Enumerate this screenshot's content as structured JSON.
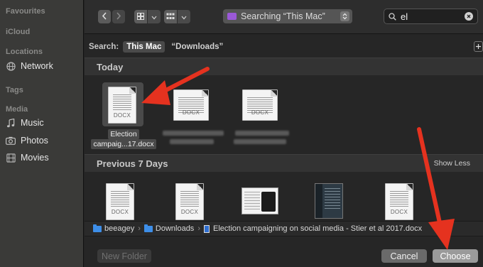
{
  "sidebar": {
    "favourites_header": "Favourites",
    "icloud_header": "iCloud",
    "locations_header": "Locations",
    "tags_header": "Tags",
    "media_header": "Media",
    "network": {
      "label": "Network",
      "icon": "globe-icon"
    },
    "music": {
      "label": "Music",
      "icon": "music-note-icon"
    },
    "photos": {
      "label": "Photos",
      "icon": "camera-icon"
    },
    "movies": {
      "label": "Movies",
      "icon": "film-icon"
    }
  },
  "toolbar": {
    "back_icon": "chevron-left-icon",
    "forward_icon": "chevron-right-icon",
    "location_label": "Searching “This Mac”",
    "search_value": "el"
  },
  "scope": {
    "label": "Search:",
    "this_mac": "This Mac",
    "downloads": "“Downloads”",
    "add_icon": "plus-icon"
  },
  "sections": {
    "today": "Today",
    "previous": "Previous 7 Days",
    "show_less": "Show Less"
  },
  "files": {
    "selected_name_line1": "Election",
    "selected_name_line2": "campaig...17.docx",
    "docx_tag": "DOCX"
  },
  "pathbar": {
    "user": "beeagey",
    "folder": "Downloads",
    "file": "Election campaigning on social media - Stier et al 2017.docx",
    "separator": "›"
  },
  "footer": {
    "new_folder": "New Folder",
    "cancel": "Cancel",
    "choose": "Choose"
  },
  "colors": {
    "annotation_arrow": "#e5321f",
    "folder_blue": "#3d8ee8",
    "accent_purple": "#9b59d8"
  }
}
